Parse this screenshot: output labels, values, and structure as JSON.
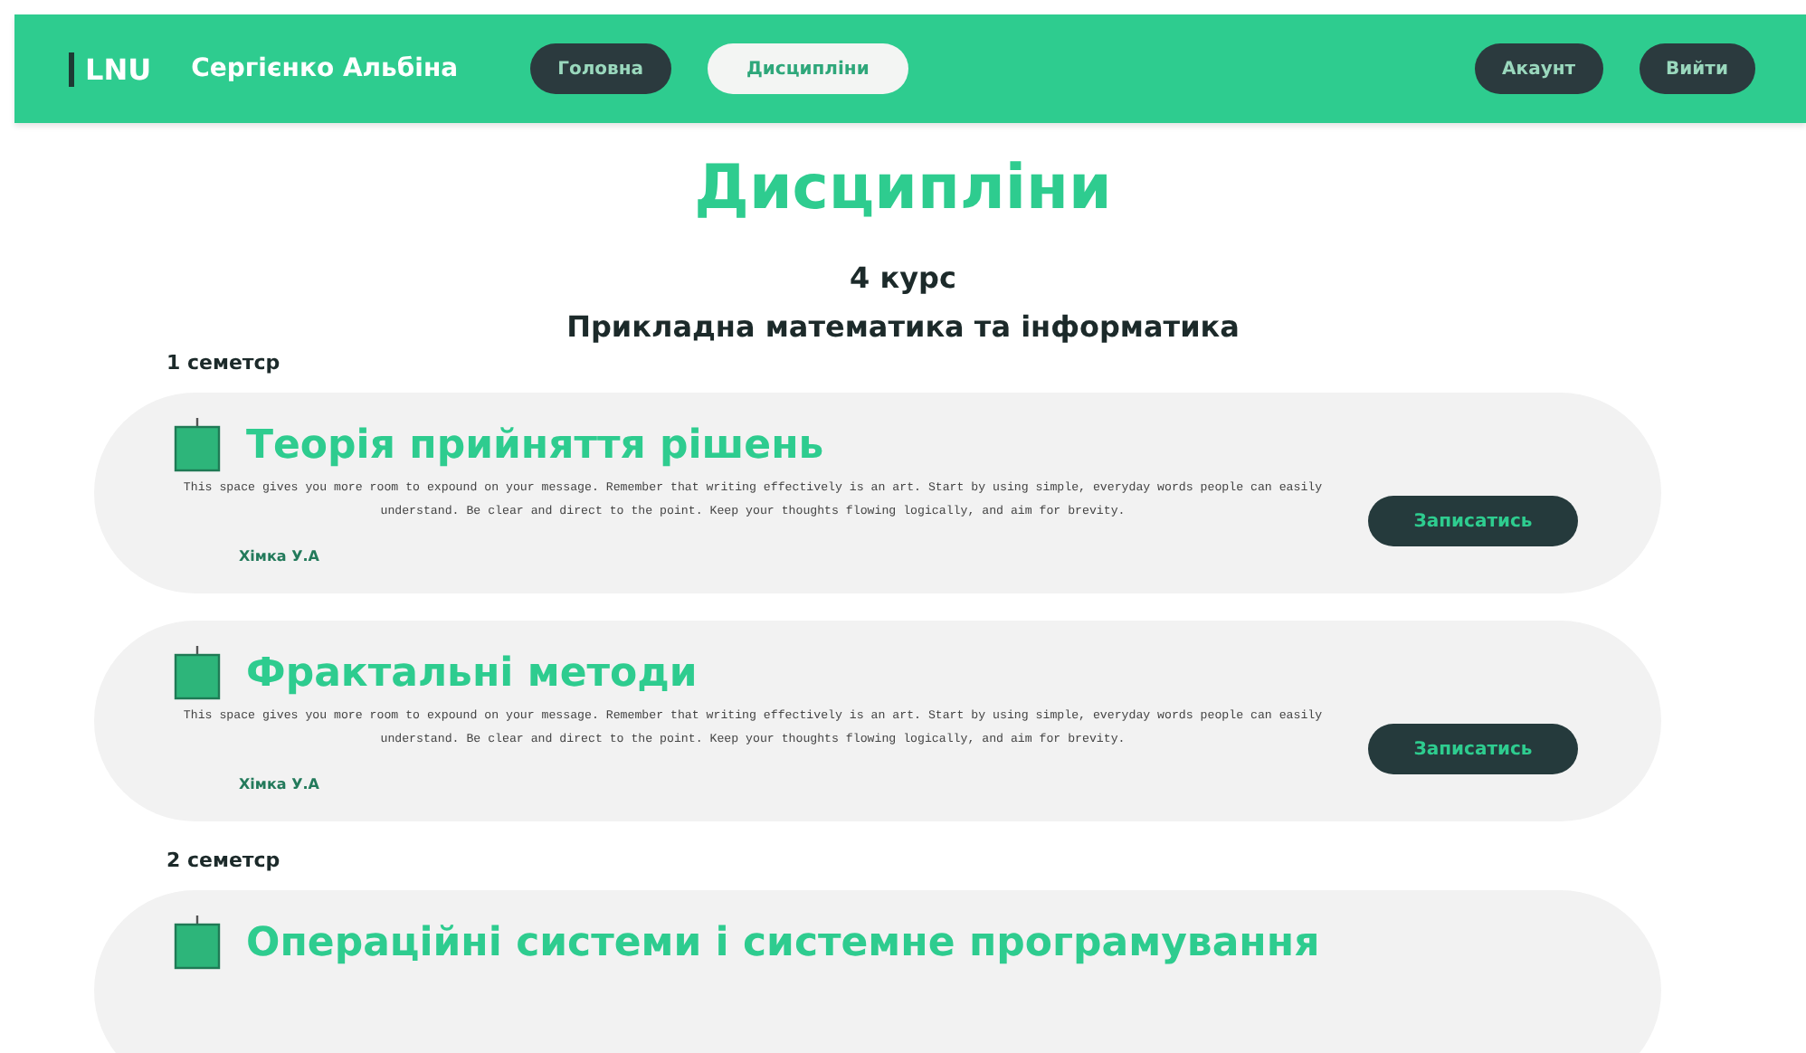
{
  "navbar": {
    "logo": "LNU",
    "user_name": "Сергієнко Альбіна",
    "tabs": [
      {
        "label": "Головна",
        "selected": false
      },
      {
        "label": "Дисципліни",
        "selected": true
      }
    ],
    "buttons": [
      "Акаунт",
      "Вийти"
    ]
  },
  "page_title": "Дисципліни",
  "course": "4 курс",
  "specialty": "Прикладна математика та інформатика",
  "semesters": [
    {
      "label": "1 семетср",
      "disciplines": [
        {
          "title": "Теорія прийняття рішень",
          "description": "This space gives you more room to expound on your message. Remember that writing effectively is an art. Start by using simple, everyday words people can easily understand. Be clear and direct to the point. Keep your thoughts flowing logically, and aim for brevity.",
          "teacher": "Хімка У.А",
          "button": "Записатись"
        },
        {
          "title": "Фрактальні методи",
          "description": "This space gives you more room to expound on your message. Remember that writing effectively is an art. Start by using simple, everyday words people can easily understand. Be clear and direct to the point. Keep your thoughts flowing logically, and aim for brevity.",
          "teacher": "Хімка У.А",
          "button": "Записатись"
        }
      ]
    },
    {
      "label": "2 семетср",
      "disciplines": [
        {
          "title": "Операційні системи і системне програмування"
        }
      ]
    }
  ]
}
